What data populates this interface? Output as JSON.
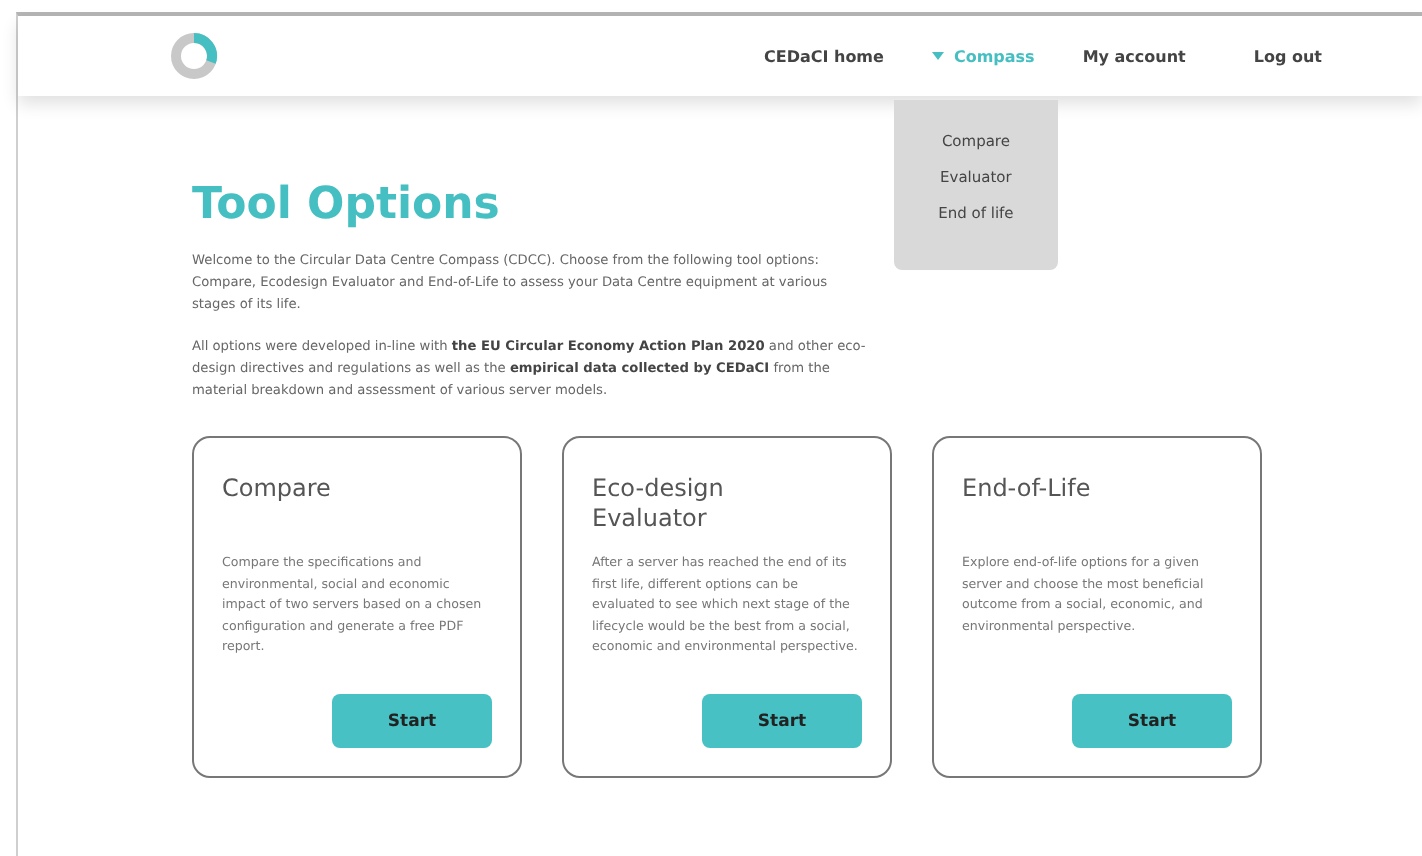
{
  "nav": {
    "items": [
      {
        "label": "CEDaCI home",
        "selected": false
      },
      {
        "label": "Compass",
        "selected": true,
        "expanded": true,
        "menu": [
          "Compare",
          "Evaluator",
          "End of life"
        ]
      },
      {
        "label": "My account",
        "selected": false
      },
      {
        "label": "Log out",
        "selected": false
      }
    ]
  },
  "title": "Tool Options",
  "paragraphs": [
    "Welcome to the Circular Data Centre Compass (CDCC). Choose from the following tool options: Compare, Ecodesign Evaluator and End-of-Life to assess your Data Centre equipment at various stages of its life.",
    "All options were developed in-line with **the EU Circular Economy Action Plan 2020** and other eco-design directives and regulations as well as the **empirical data collected by CEDaCI** from the material breakdown and assessment of various server models."
  ],
  "cards": [
    {
      "title": "Compare",
      "text": "Compare the specifications and environmental, social and economic impact of two servers based on a chosen configuration and generate a free PDF report.",
      "button": "Start"
    },
    {
      "title": "Eco-design Evaluator",
      "text": "After a server has reached the end of its first life, different options can be evaluated to see which next stage of the lifecycle would be the best from a social, economic and environmental perspective.",
      "button": "Start"
    },
    {
      "title": "End-of-Life",
      "text": "Explore end-of-life options for a given server and choose the most beneficial outcome from a social, economic, and environmental perspective.",
      "button": "Start"
    }
  ]
}
